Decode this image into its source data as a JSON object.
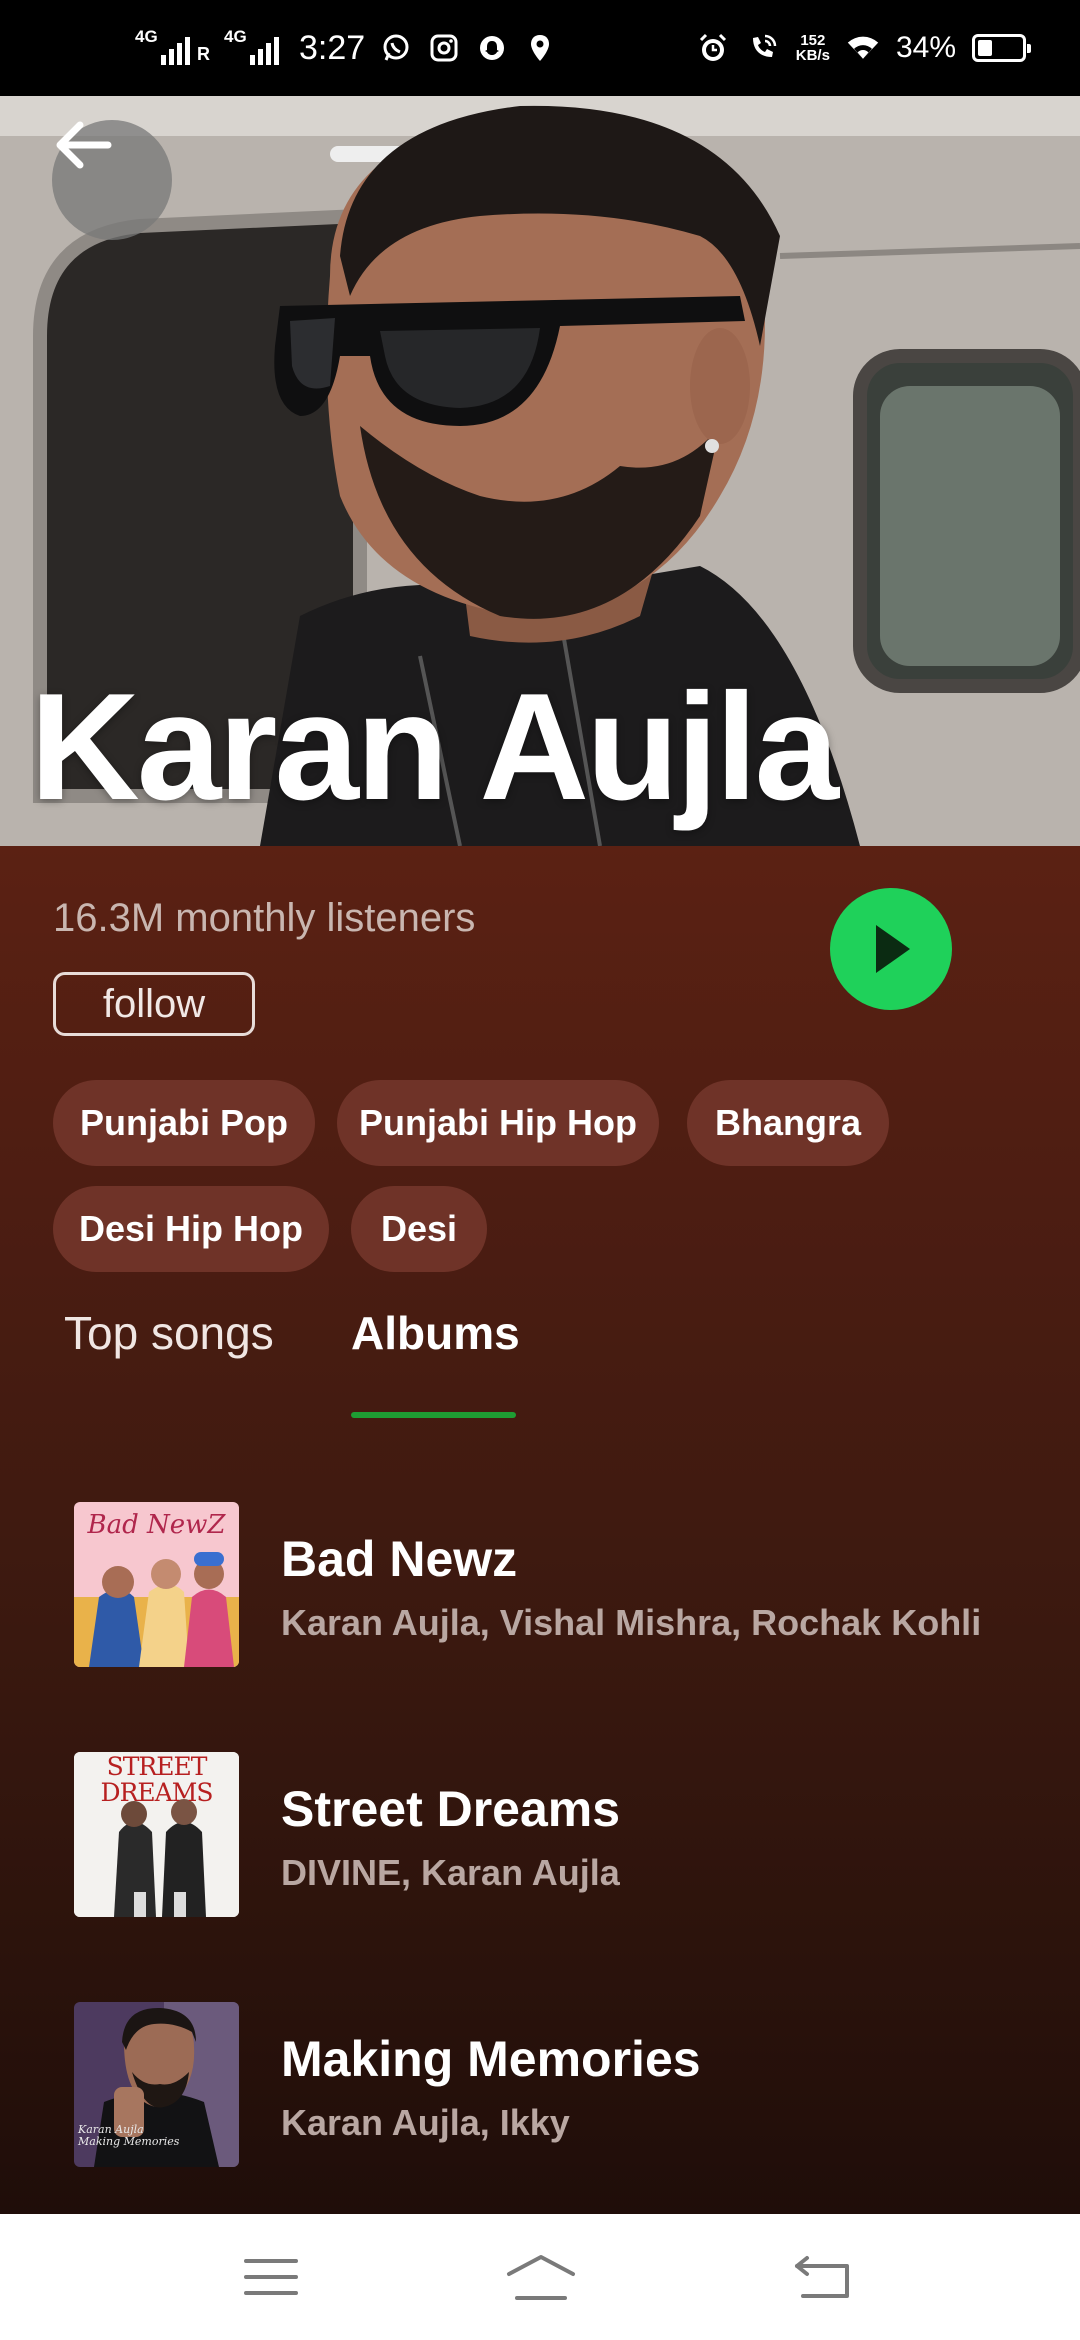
{
  "status_bar": {
    "network1": "4G",
    "roaming": "R",
    "network2": "4G",
    "time": "3:27",
    "icons_left": [
      "whatsapp-icon",
      "instagram-icon",
      "snapchat-icon",
      "maps-pin-icon"
    ],
    "icons_right": [
      "alarm-icon",
      "wifi-calling-icon"
    ],
    "speed_value": "152",
    "speed_unit": "KB/s",
    "battery_percent": "34%",
    "battery_level": 0.34
  },
  "hero": {
    "back_icon": "arrow-left-icon",
    "artist_name": "Karan Aujla"
  },
  "artist": {
    "monthly_listeners": "16.3M monthly listeners",
    "follow_label": "follow",
    "play_icon": "play-icon",
    "accent_color": "#1fd15a",
    "genres": [
      "Punjabi Pop",
      "Punjabi Hip Hop",
      "Bhangra",
      "Desi Hip Hop",
      "Desi"
    ]
  },
  "tabs": [
    {
      "label": "Top songs",
      "active": false
    },
    {
      "label": "Albums",
      "active": true
    }
  ],
  "albums": [
    {
      "title": "Bad Newz",
      "artists": "Karan Aujla, Vishal Mishra, Rochak Kohli",
      "cover_text": "Bad NewZ"
    },
    {
      "title": "Street Dreams",
      "artists": "DIVINE, Karan Aujla",
      "cover_text": "STREET DREAMS"
    },
    {
      "title": "Making Memories",
      "artists": "Karan Aujla, Ikky",
      "cover_text": "Karan Aujla Making Memories"
    }
  ],
  "nav_bar": {
    "icons": [
      "menu-icon",
      "home-icon",
      "back-icon"
    ]
  }
}
